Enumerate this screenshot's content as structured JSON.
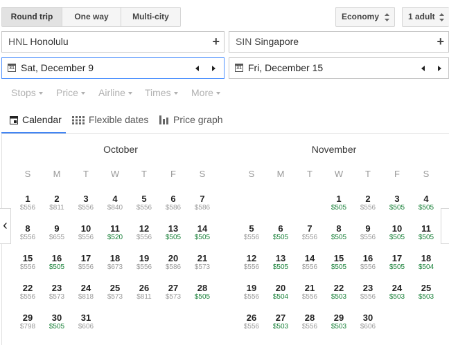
{
  "trip_types": [
    "Round trip",
    "One way",
    "Multi-city"
  ],
  "active_trip_type": "Round trip",
  "cabin_class": "Economy",
  "passengers": "1 adult",
  "origin": {
    "code": "HNL",
    "city": "Honolulu"
  },
  "destination": {
    "code": "SIN",
    "city": "Singapore"
  },
  "depart_date": "Sat, December 9",
  "return_date": "Fri, December 15",
  "calendar_icon_glyph": "31",
  "filters": [
    "Stops",
    "Price",
    "Airline",
    "Times",
    "More"
  ],
  "view_tabs": [
    "Calendar",
    "Flexible dates",
    "Price graph"
  ],
  "active_view_tab": "Calendar",
  "weekdays": [
    "S",
    "M",
    "T",
    "W",
    "T",
    "F",
    "S"
  ],
  "colors": {
    "cheap_price": "#188038",
    "regular_price": "#999999",
    "focus_border": "#4d90fe",
    "active_tab_underline": "#4285f4"
  },
  "months": [
    {
      "name": "October",
      "first_weekday": 0,
      "days": [
        {
          "day": "1",
          "price": "$556",
          "cheap": false
        },
        {
          "day": "2",
          "price": "$811",
          "cheap": false
        },
        {
          "day": "3",
          "price": "$556",
          "cheap": false
        },
        {
          "day": "4",
          "price": "$840",
          "cheap": false
        },
        {
          "day": "5",
          "price": "$556",
          "cheap": false
        },
        {
          "day": "6",
          "price": "$586",
          "cheap": false
        },
        {
          "day": "7",
          "price": "$586",
          "cheap": false
        },
        {
          "day": "8",
          "price": "$556",
          "cheap": false
        },
        {
          "day": "9",
          "price": "$655",
          "cheap": false
        },
        {
          "day": "10",
          "price": "$556",
          "cheap": false
        },
        {
          "day": "11",
          "price": "$520",
          "cheap": true
        },
        {
          "day": "12",
          "price": "$556",
          "cheap": false
        },
        {
          "day": "13",
          "price": "$505",
          "cheap": true
        },
        {
          "day": "14",
          "price": "$505",
          "cheap": true
        },
        {
          "day": "15",
          "price": "$556",
          "cheap": false
        },
        {
          "day": "16",
          "price": "$505",
          "cheap": true
        },
        {
          "day": "17",
          "price": "$556",
          "cheap": false
        },
        {
          "day": "18",
          "price": "$673",
          "cheap": false
        },
        {
          "day": "19",
          "price": "$556",
          "cheap": false
        },
        {
          "day": "20",
          "price": "$586",
          "cheap": false
        },
        {
          "day": "21",
          "price": "$573",
          "cheap": false
        },
        {
          "day": "22",
          "price": "$556",
          "cheap": false
        },
        {
          "day": "23",
          "price": "$573",
          "cheap": false
        },
        {
          "day": "24",
          "price": "$818",
          "cheap": false
        },
        {
          "day": "25",
          "price": "$573",
          "cheap": false
        },
        {
          "day": "26",
          "price": "$811",
          "cheap": false
        },
        {
          "day": "27",
          "price": "$573",
          "cheap": false
        },
        {
          "day": "28",
          "price": "$505",
          "cheap": true
        },
        {
          "day": "29",
          "price": "$798",
          "cheap": false
        },
        {
          "day": "30",
          "price": "$505",
          "cheap": true
        },
        {
          "day": "31",
          "price": "$606",
          "cheap": false
        }
      ]
    },
    {
      "name": "November",
      "first_weekday": 3,
      "days": [
        {
          "day": "1",
          "price": "$505",
          "cheap": true
        },
        {
          "day": "2",
          "price": "$556",
          "cheap": false
        },
        {
          "day": "3",
          "price": "$505",
          "cheap": true
        },
        {
          "day": "4",
          "price": "$505",
          "cheap": true
        },
        {
          "day": "5",
          "price": "$556",
          "cheap": false
        },
        {
          "day": "6",
          "price": "$505",
          "cheap": true
        },
        {
          "day": "7",
          "price": "$556",
          "cheap": false
        },
        {
          "day": "8",
          "price": "$505",
          "cheap": true
        },
        {
          "day": "9",
          "price": "$556",
          "cheap": false
        },
        {
          "day": "10",
          "price": "$505",
          "cheap": true
        },
        {
          "day": "11",
          "price": "$505",
          "cheap": true
        },
        {
          "day": "12",
          "price": "$556",
          "cheap": false
        },
        {
          "day": "13",
          "price": "$505",
          "cheap": true
        },
        {
          "day": "14",
          "price": "$556",
          "cheap": false
        },
        {
          "day": "15",
          "price": "$505",
          "cheap": true
        },
        {
          "day": "16",
          "price": "$556",
          "cheap": false
        },
        {
          "day": "17",
          "price": "$505",
          "cheap": true
        },
        {
          "day": "18",
          "price": "$504",
          "cheap": true
        },
        {
          "day": "19",
          "price": "$556",
          "cheap": false
        },
        {
          "day": "20",
          "price": "$504",
          "cheap": true
        },
        {
          "day": "21",
          "price": "$556",
          "cheap": false
        },
        {
          "day": "22",
          "price": "$503",
          "cheap": true
        },
        {
          "day": "23",
          "price": "$556",
          "cheap": false
        },
        {
          "day": "24",
          "price": "$503",
          "cheap": true
        },
        {
          "day": "25",
          "price": "$503",
          "cheap": true
        },
        {
          "day": "26",
          "price": "$556",
          "cheap": false
        },
        {
          "day": "27",
          "price": "$503",
          "cheap": true
        },
        {
          "day": "28",
          "price": "$556",
          "cheap": false
        },
        {
          "day": "29",
          "price": "$503",
          "cheap": true
        },
        {
          "day": "30",
          "price": "$606",
          "cheap": false
        }
      ]
    }
  ]
}
